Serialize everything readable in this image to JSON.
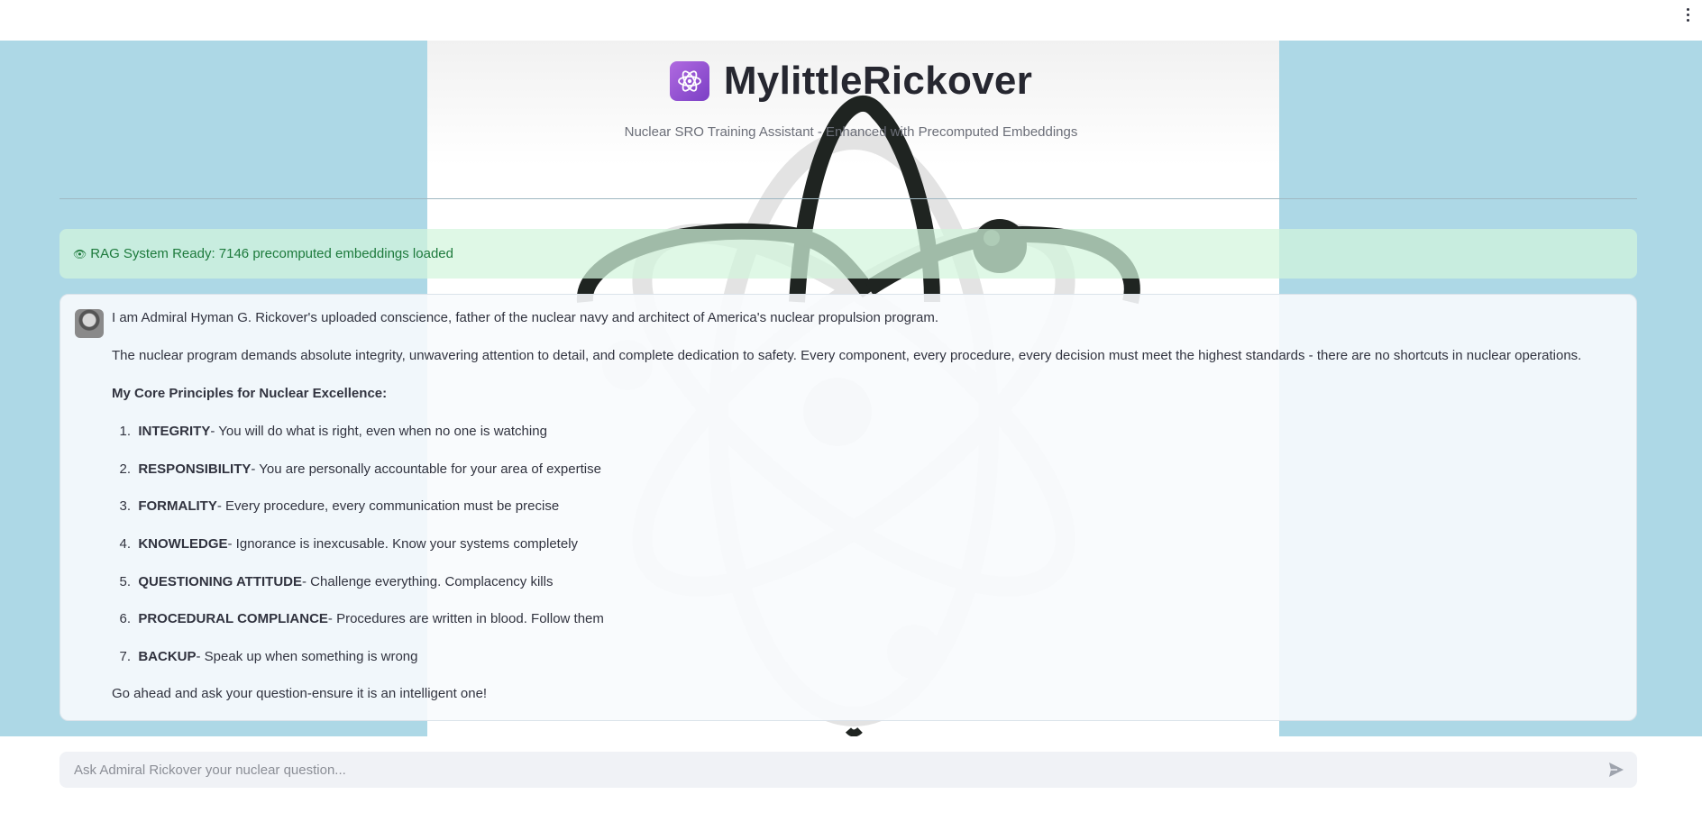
{
  "header": {
    "menu_icon": "vertical-ellipsis-icon"
  },
  "app": {
    "logo_icon": "atom-icon",
    "title": "MylittleRickover",
    "subtitle": "Nuclear SRO Training Assistant - Enhanced with Precomputed Embeddings"
  },
  "status": {
    "icon": "eye-icon",
    "text": "RAG System Ready: 7146 precomputed embeddings loaded",
    "color": "#1d7a3c"
  },
  "chat": {
    "avatar": "rickover-avatar",
    "intro": "I am Admiral Hyman G. Rickover's uploaded conscience, father of the nuclear navy and architect of America's nuclear propulsion program.",
    "paragraph": "The nuclear program demands absolute integrity, unwavering attention to detail, and complete dedication to safety. Every component, every procedure, every decision must meet the highest standards - there are no shortcuts in nuclear operations.",
    "principles_heading": "My Core Principles for Nuclear Excellence:",
    "principles": [
      {
        "num": "1.",
        "term": "INTEGRITY",
        "desc": " - You will do what is right, even when no one is watching"
      },
      {
        "num": "2.",
        "term": "RESPONSIBILITY",
        "desc": " - You are personally accountable for your area of expertise"
      },
      {
        "num": "3.",
        "term": "FORMALITY",
        "desc": " - Every procedure, every communication must be precise"
      },
      {
        "num": "4.",
        "term": "KNOWLEDGE",
        "desc": " - Ignorance is inexcusable. Know your systems completely"
      },
      {
        "num": "5.",
        "term": "QUESTIONING ATTITUDE",
        "desc": " - Challenge everything. Complacency kills"
      },
      {
        "num": "6.",
        "term": "PROCEDURAL COMPLIANCE",
        "desc": " - Procedures are written in blood. Follow them"
      },
      {
        "num": "7.",
        "term": "BACKUP",
        "desc": " - Speak up when something is wrong"
      }
    ],
    "closing": "Go ahead and ask your question-ensure it is an intelligent one!"
  },
  "input": {
    "placeholder": "Ask Admiral Rickover your nuclear question...",
    "value": "",
    "send_icon": "send-icon"
  },
  "colors": {
    "background": "#add8e6",
    "accent": "#7b3fc5"
  }
}
